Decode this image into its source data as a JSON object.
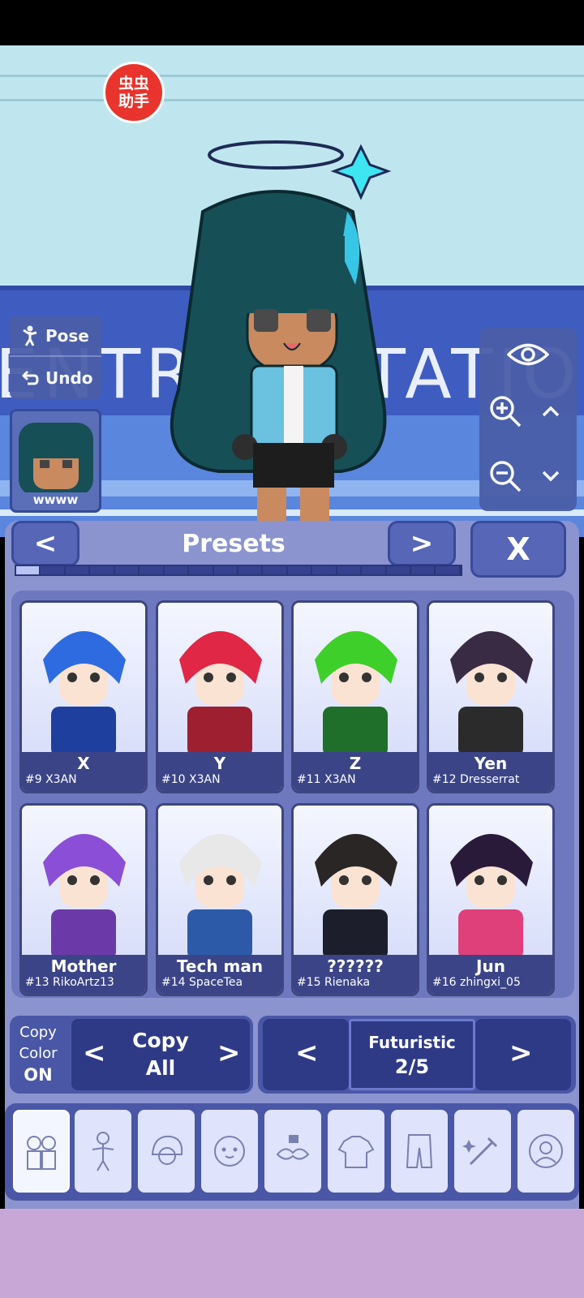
{
  "helper_badge": {
    "text": "虫虫助手"
  },
  "scene": {
    "sign_text": "ENTRAL STATIO"
  },
  "side_panel": {
    "pose_label": "Pose",
    "undo_label": "Undo"
  },
  "portrait": {
    "name": "wwww"
  },
  "presets": {
    "title": "Presets",
    "prev_symbol": "<",
    "next_symbol": ">",
    "close_symbol": "X",
    "progress": {
      "current": 1,
      "total": 18
    },
    "cards": [
      {
        "name": "X",
        "sub": "#9 X3AN",
        "hair": "#2f6be0",
        "outfit": "#1f3f9e"
      },
      {
        "name": "Y",
        "sub": "#10 X3AN",
        "hair": "#e02745",
        "outfit": "#9e1f2f"
      },
      {
        "name": "Z",
        "sub": "#11 X3AN",
        "hair": "#3fcf2a",
        "outfit": "#1f6e2a"
      },
      {
        "name": "Yen",
        "sub": "#12 Dresserrat",
        "hair": "#3a2b44",
        "outfit": "#2b2b2b"
      },
      {
        "name": "Mother",
        "sub": "#13 RikoArtz13",
        "hair": "#8a4fd6",
        "outfit": "#6b3aa8"
      },
      {
        "name": "Tech man",
        "sub": "#14 SpaceTea",
        "hair": "#e8e8e8",
        "outfit": "#2d5aa8"
      },
      {
        "name": "??????",
        "sub": "#15 Rienaka",
        "hair": "#2a2626",
        "outfit": "#1c1f2b"
      },
      {
        "name": "Jun",
        "sub": "#16 zhingxi_05",
        "hair": "#2a1a3a",
        "outfit": "#e0407a"
      }
    ]
  },
  "copy": {
    "color_label": "Copy\nColor",
    "color_label_line1": "Copy",
    "color_label_line2": "Color",
    "color_state": "ON",
    "all_label_line1": "Copy",
    "all_label_line2": "All",
    "prev_symbol": "<",
    "next_symbol": ">"
  },
  "category": {
    "name": "Futuristic",
    "page": "2/5",
    "prev_symbol": "<",
    "next_symbol": ">"
  },
  "tabs": [
    {
      "icon": "presets-icon"
    },
    {
      "icon": "body-icon"
    },
    {
      "icon": "hair-icon"
    },
    {
      "icon": "face-icon"
    },
    {
      "icon": "accessories-icon"
    },
    {
      "icon": "top-icon"
    },
    {
      "icon": "bottom-icon"
    },
    {
      "icon": "props-icon"
    },
    {
      "icon": "profile-icon"
    }
  ],
  "colors": {
    "panel": "#8b94cf",
    "dark_button": "#2f3a87",
    "label_bg": "#3b4487",
    "accent_red": "#e8342c"
  }
}
